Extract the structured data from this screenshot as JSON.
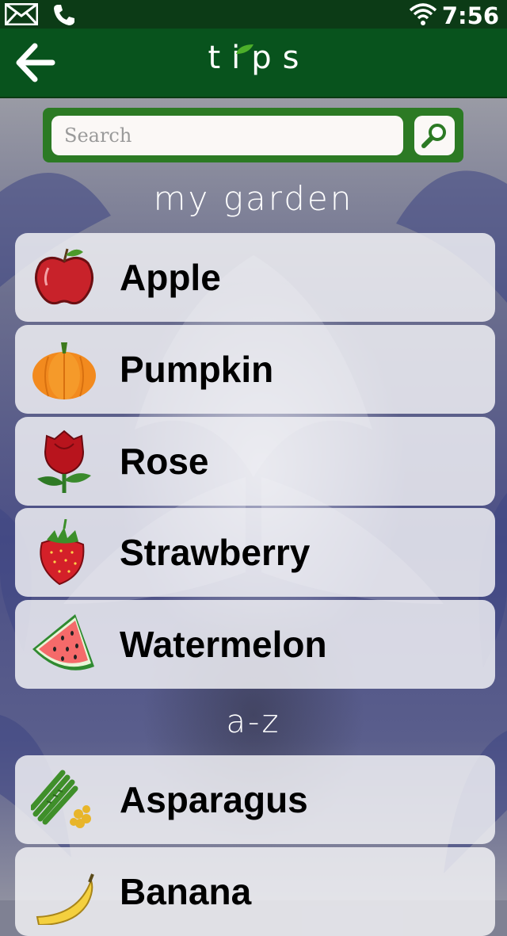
{
  "status_bar": {
    "time": "7:56"
  },
  "app_bar": {
    "title": "tips"
  },
  "search": {
    "placeholder": "Search",
    "value": ""
  },
  "sections": {
    "garden_title": "my garden",
    "az_title": "a-z"
  },
  "garden_items": [
    {
      "label": "Apple",
      "icon": "apple-icon"
    },
    {
      "label": "Pumpkin",
      "icon": "pumpkin-icon"
    },
    {
      "label": "Rose",
      "icon": "rose-icon"
    },
    {
      "label": "Strawberry",
      "icon": "strawberry-icon"
    },
    {
      "label": "Watermelon",
      "icon": "watermelon-icon"
    }
  ],
  "az_items": [
    {
      "label": "Asparagus",
      "icon": "asparagus-icon"
    },
    {
      "label": "Banana",
      "icon": "banana-icon"
    }
  ],
  "colors": {
    "status_bar": "#0c3b16",
    "app_bar": "#08531d",
    "search_frame": "#2c7a24"
  }
}
